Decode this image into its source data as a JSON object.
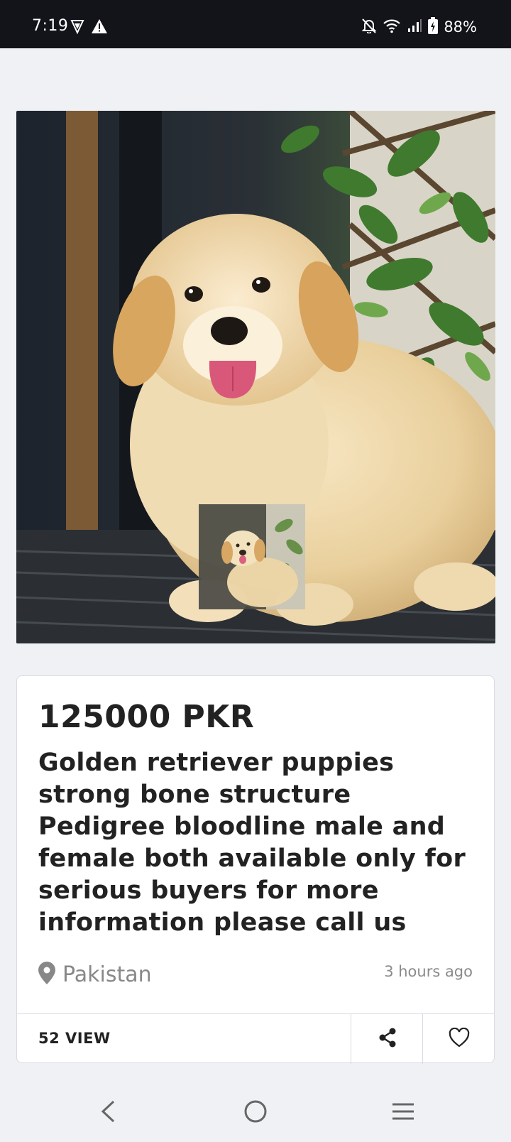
{
  "status_bar": {
    "time": "7:19",
    "battery": "88%"
  },
  "listing": {
    "price": "125000 PKR",
    "title": "Golden retriever puppies strong bone structure Pedigree bloodline male and female both available only for serious buyers for more information please call us",
    "location": "Pakistan",
    "posted": "3 hours ago",
    "views": "52 VIEW"
  },
  "colors": {
    "background": "#f0f1f5",
    "text": "#222222",
    "muted": "#888888",
    "status_bar": "#12141a"
  },
  "icons": {
    "vpn": "shield-icon",
    "alert": "warning-icon",
    "mute": "bell-off-icon",
    "wifi": "wifi-icon",
    "signal": "signal-icon",
    "battery": "battery-icon",
    "location": "location-pin-icon",
    "share": "share-icon",
    "favorite": "heart-icon",
    "back": "back-icon",
    "home": "home-icon",
    "menu": "menu-icon"
  }
}
